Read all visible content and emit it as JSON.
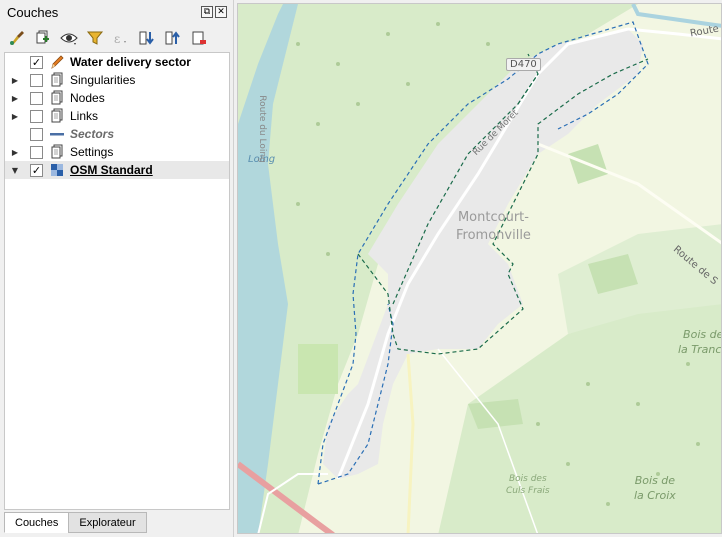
{
  "panel": {
    "title": "Couches",
    "float_glyph": "⧉",
    "close_glyph": "✕"
  },
  "toolbar": {
    "buttons": [
      {
        "name": "style-manager-icon"
      },
      {
        "name": "add-group-icon"
      },
      {
        "name": "visibility-icon"
      },
      {
        "name": "filter-legend-icon"
      },
      {
        "name": "filter-expression-icon"
      },
      {
        "name": "expand-all-icon"
      },
      {
        "name": "collapse-all-icon"
      },
      {
        "name": "remove-layer-icon"
      }
    ]
  },
  "layers": [
    {
      "label": "Water delivery sector",
      "checked": "✓",
      "expand": "",
      "style": "bold",
      "icon": "pencil-icon"
    },
    {
      "label": "Singularities",
      "checked": "",
      "expand": "▶",
      "style": "normal",
      "icon": "group-icon"
    },
    {
      "label": "Nodes",
      "checked": "",
      "expand": "▶",
      "style": "normal",
      "icon": "group-icon"
    },
    {
      "label": "Links",
      "checked": "",
      "expand": "▶",
      "style": "normal",
      "icon": "group-icon"
    },
    {
      "label": "Sectors",
      "checked": "",
      "expand": "",
      "style": "italic",
      "icon": "line-icon"
    },
    {
      "label": "Settings",
      "checked": "",
      "expand": "▶",
      "style": "normal",
      "icon": "group-icon"
    },
    {
      "label": "OSM Standard",
      "checked": "✓",
      "expand": "▼",
      "style": "underline",
      "icon": "raster-icon"
    }
  ],
  "tabs": [
    {
      "label": "Couches",
      "active": true
    },
    {
      "label": "Explorateur",
      "active": false
    }
  ],
  "map": {
    "road_ref": "D470",
    "town": "Montcourt-Fromonville",
    "town_line1": "Montcourt-",
    "town_line2": "Fromonville",
    "route_top_right": "Route",
    "route_right": "Route de S",
    "river_label": "Loing",
    "canal_label": "Route du Loing",
    "rue_label": "Rue de Moret",
    "woods": [
      {
        "line1": "Bois de",
        "line2": "la Tranch"
      },
      {
        "line1": "Bois des",
        "line2": "Culs Frais"
      },
      {
        "line1": "Bois de",
        "line2": "la Croix"
      }
    ],
    "colors": {
      "forest": "#d8ebc9",
      "forest_dark": "#c6e1b3",
      "field": "#f2f6e2",
      "urban": "#e9e9e9",
      "water": "#aad3df",
      "sector_outline": "#1a6b4a",
      "parent_outline": "#2a6fb5"
    }
  }
}
